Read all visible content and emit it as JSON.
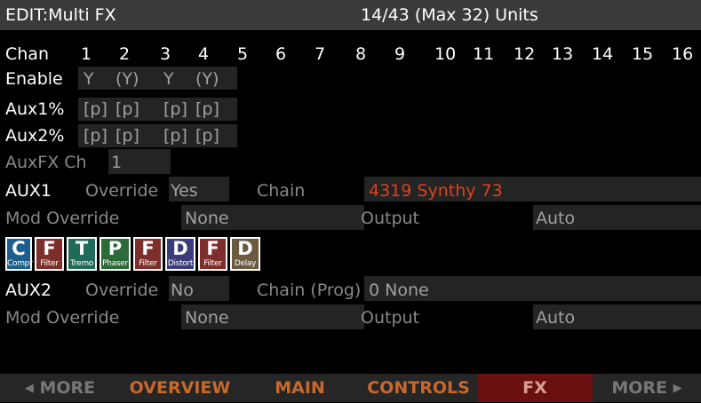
{
  "header": {
    "title": "EDIT:Multi FX",
    "units": "14/43 (Max 32) Units"
  },
  "grid": {
    "chan_label": "Chan",
    "channels": [
      "1",
      "2",
      "3",
      "4",
      "5",
      "6",
      "7",
      "8",
      "9",
      "10",
      "11",
      "12",
      "13",
      "14",
      "15",
      "16"
    ],
    "enable_label": "Enable",
    "enable_values": [
      "Y",
      "(Y)",
      "Y",
      "(Y)"
    ],
    "aux1_label": "Aux1%",
    "aux1_values": [
      "[p]",
      "[p]",
      "[p]",
      "[p]"
    ],
    "aux2_label": "Aux2%",
    "aux2_values": [
      "[p]",
      "[p]",
      "[p]",
      "[p]"
    ],
    "auxfx_label": "AuxFX Ch",
    "auxfx_value": "1"
  },
  "aux1": {
    "label": "AUX1",
    "override_label": "Override",
    "override_value": "Yes",
    "chain_label": "Chain",
    "chain_value": "4319 Synthy 73",
    "mod_label": "Mod Override",
    "mod_value": "None",
    "output_label": "Output",
    "output_value": "Auto"
  },
  "fx_blocks": [
    {
      "letter": "C",
      "name": "Compr",
      "color": "#1d5f8c",
      "icon": "compressor-icon"
    },
    {
      "letter": "F",
      "name": "Filter",
      "color": "#7e2f2c",
      "icon": "filter-icon"
    },
    {
      "letter": "T",
      "name": "Tremo",
      "color": "#1f6b58",
      "icon": "tremolo-icon"
    },
    {
      "letter": "P",
      "name": "Phaser",
      "color": "#2c6a3a",
      "icon": "phaser-icon"
    },
    {
      "letter": "F",
      "name": "Filter",
      "color": "#7e2f2c",
      "icon": "filter-icon"
    },
    {
      "letter": "D",
      "name": "Distort",
      "color": "#3b3c7c",
      "icon": "distortion-icon"
    },
    {
      "letter": "F",
      "name": "Filter",
      "color": "#7e2f2c",
      "icon": "filter-icon"
    },
    {
      "letter": "D",
      "name": "Delay",
      "color": "#6b5a40",
      "icon": "delay-icon"
    }
  ],
  "aux2": {
    "label": "AUX2",
    "override_label": "Override",
    "override_value": "No",
    "chain_label": "Chain (Prog)",
    "chain_value": "0 None",
    "mod_label": "Mod Override",
    "mod_value": "None",
    "output_label": "Output",
    "output_value": "Auto"
  },
  "tabs": [
    {
      "label": "MORE",
      "arrow": "◀",
      "kind": "more-left"
    },
    {
      "label": "OVERVIEW"
    },
    {
      "label": "MAIN"
    },
    {
      "label": "CONTROLS"
    },
    {
      "label": "FX",
      "active": true
    },
    {
      "label": "MORE",
      "arrow": "▶",
      "kind": "more-right"
    }
  ]
}
